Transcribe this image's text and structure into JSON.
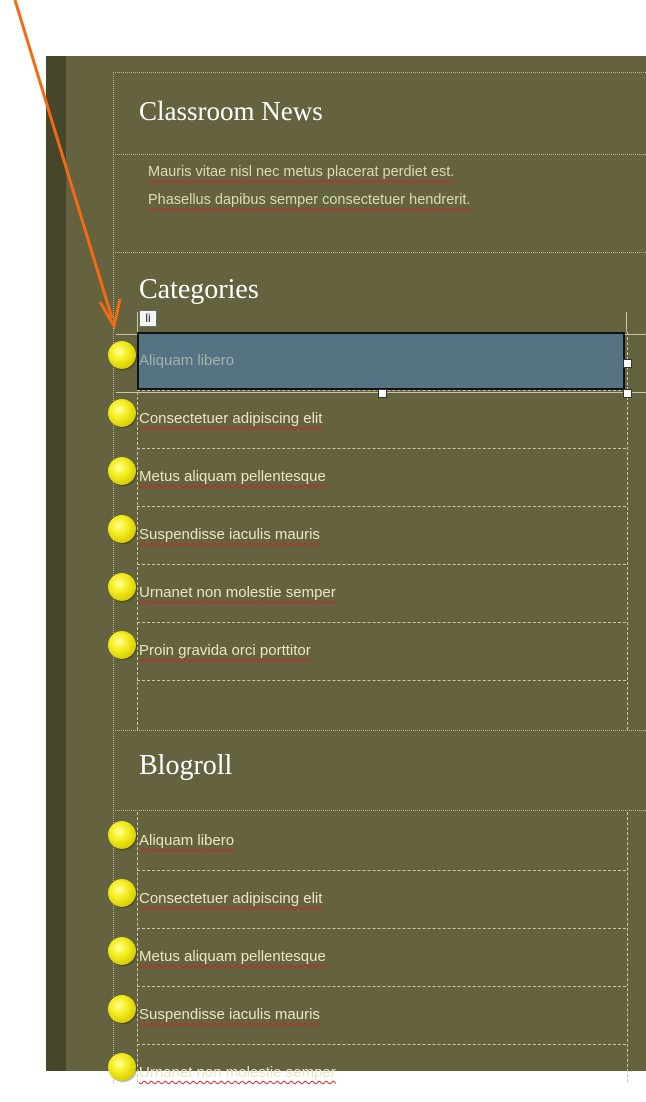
{
  "classroom_news": {
    "title": "Classroom News",
    "text_line1": "Mauris vitae nisl nec metus placerat perdiet est.",
    "text_line2": "Phasellus dapibus semper consectetuer hendrerit."
  },
  "categories": {
    "title": "Categories",
    "selected_tag": "li",
    "items": [
      "Aliquam libero",
      "Consectetuer adipiscing elit",
      "Metus aliquam pellentesque",
      "Suspendisse iaculis mauris",
      "Urnanet non molestie semper",
      "Proin gravida orci porttitor"
    ]
  },
  "blogroll": {
    "title": "Blogroll",
    "items": [
      "Aliquam libero",
      "Consectetuer adipiscing elit",
      "Metus aliquam pellentesque",
      "Suspendisse iaculis mauris",
      "Urnanet non molestie semper"
    ]
  },
  "colors": {
    "panel": "#65633f",
    "strip": "#46462a",
    "selection": "#567383",
    "arrow": "#f26b12",
    "bullet": "#f4ee20"
  },
  "icons": {
    "annotation": "orange-arrow-icon",
    "bullet": "yellow-ball-bullet-icon"
  }
}
